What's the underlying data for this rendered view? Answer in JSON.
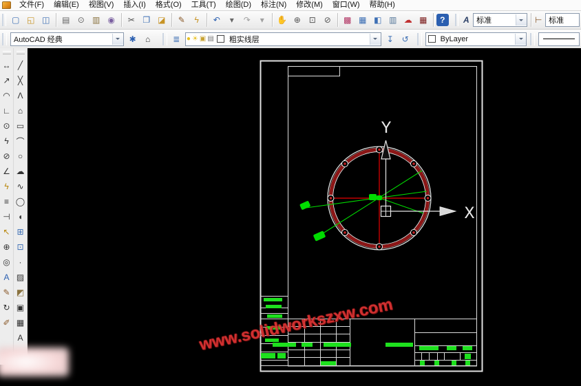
{
  "menu_bar": {
    "items": [
      "文件(F)",
      "编辑(E)",
      "视图(V)",
      "插入(I)",
      "格式(O)",
      "工具(T)",
      "绘图(D)",
      "标注(N)",
      "修改(M)",
      "窗口(W)",
      "帮助(H)"
    ]
  },
  "standard_toolbar": {
    "buttons": [
      {
        "name": "new-file",
        "glyph": "▢",
        "color": "#3d6fb4"
      },
      {
        "name": "open-file",
        "glyph": "◱",
        "color": "#c79324"
      },
      {
        "name": "save-file",
        "glyph": "◫",
        "color": "#3d6fb4"
      },
      {
        "sep": true
      },
      {
        "name": "plot",
        "glyph": "▤",
        "color": "#666666"
      },
      {
        "name": "plot-preview",
        "glyph": "⊙",
        "color": "#666666"
      },
      {
        "name": "publish",
        "glyph": "▥",
        "color": "#8a7340"
      },
      {
        "name": "3d-dwf",
        "glyph": "◉",
        "color": "#7a5fa0"
      },
      {
        "sep": true
      },
      {
        "name": "cut",
        "glyph": "✂",
        "color": "#555555"
      },
      {
        "name": "copy",
        "glyph": "❐",
        "color": "#3d6fb4"
      },
      {
        "name": "paste",
        "glyph": "◪",
        "color": "#c79324"
      },
      {
        "sep": true
      },
      {
        "name": "match-properties",
        "glyph": "✎",
        "color": "#8a5a2a"
      },
      {
        "name": "block-editor",
        "glyph": "ϟ",
        "color": "#c79324"
      },
      {
        "sep": true
      },
      {
        "name": "undo",
        "glyph": "↶",
        "color": "#2b5fb0"
      },
      {
        "name": "undo-options",
        "glyph": "▾",
        "color": "#666666"
      },
      {
        "name": "redo",
        "glyph": "↷",
        "color": "#a0a0a0"
      },
      {
        "name": "redo-options",
        "glyph": "▾",
        "color": "#a0a0a0"
      },
      {
        "sep": true
      },
      {
        "name": "pan-realtime",
        "glyph": "✋",
        "color": "#c79324"
      },
      {
        "name": "zoom-realtime",
        "glyph": "⊕",
        "color": "#555555"
      },
      {
        "name": "zoom-window",
        "glyph": "⊡",
        "color": "#555555"
      },
      {
        "name": "zoom-previous",
        "glyph": "⊘",
        "color": "#555555"
      },
      {
        "sep": true
      },
      {
        "name": "properties-palette",
        "glyph": "▩",
        "color": "#b03060"
      },
      {
        "name": "designcenter",
        "glyph": "▦",
        "color": "#3d6fb4"
      },
      {
        "name": "tool-palettes",
        "glyph": "◧",
        "color": "#3d6fb4"
      },
      {
        "name": "sheet-set-manager",
        "glyph": "▥",
        "color": "#557799"
      },
      {
        "name": "markup-set-manager",
        "glyph": "☁",
        "color": "#c03030"
      },
      {
        "name": "quickcalc",
        "glyph": "▦",
        "color": "#7a1a1a"
      },
      {
        "sep": true
      },
      {
        "name": "help",
        "glyph": "?",
        "color": "#ffffff",
        "bg": "#2b5fb0"
      }
    ]
  },
  "styles_toolbar": {
    "text_style_icon": {
      "name": "text-style-manager",
      "glyph": "A",
      "color": "#2b3f66"
    },
    "text_style_value": "标准",
    "dim_style_icon": {
      "name": "dim-style-manager",
      "glyph": "⊢",
      "color": "#8a5a2a"
    },
    "dim_style_value": "标准"
  },
  "workspace_toolbar": {
    "workspace_value": "AutoCAD 经典",
    "buttons": [
      {
        "name": "workspace-settings",
        "glyph": "✱",
        "color": "#2b5fb0"
      },
      {
        "name": "my-workspace",
        "glyph": "⌂",
        "color": "#333333"
      }
    ]
  },
  "layer_toolbar": {
    "manager_button": {
      "name": "layer-properties-manager",
      "glyph": "≣",
      "color": "#3d6fb4"
    },
    "state_icons": [
      {
        "name": "layer-on-icon",
        "glyph": "●",
        "color": "#e8c020"
      },
      {
        "name": "layer-freeze-icon",
        "glyph": "☀",
        "color": "#e8c020"
      },
      {
        "name": "layer-lock-icon",
        "glyph": "▣",
        "color": "#c7a334"
      },
      {
        "name": "layer-plot-icon",
        "glyph": "▤",
        "color": "#777777"
      }
    ],
    "current_layer": "粗实线层",
    "buttons": [
      {
        "name": "make-object-layer-current",
        "glyph": "↧",
        "color": "#3d6fb4"
      },
      {
        "name": "layer-previous",
        "glyph": "↺",
        "color": "#3d6fb4"
      }
    ]
  },
  "properties_toolbar": {
    "color_value": "ByLayer"
  },
  "dimension_toolbar": {
    "buttons": [
      {
        "name": "linear-dimension",
        "glyph": "↔",
        "color": "#333333"
      },
      {
        "name": "aligned-dimension",
        "glyph": "↗",
        "color": "#333333"
      },
      {
        "name": "arc-length-dimension",
        "glyph": "◠",
        "color": "#333333"
      },
      {
        "name": "ordinate-dimension",
        "glyph": "∟",
        "color": "#333333"
      },
      {
        "name": "radius-dimension",
        "glyph": "⊙",
        "color": "#333333"
      },
      {
        "name": "jogged-dimension",
        "glyph": "ϟ",
        "color": "#333333"
      },
      {
        "name": "diameter-dimension",
        "glyph": "⊘",
        "color": "#333333"
      },
      {
        "name": "angular-dimension",
        "glyph": "∠",
        "color": "#333333"
      },
      {
        "name": "quick-dimension",
        "glyph": "ϟ",
        "color": "#b8860b"
      },
      {
        "name": "baseline-dimension",
        "glyph": "≡",
        "color": "#333333"
      },
      {
        "name": "continue-dimension",
        "glyph": "⊣",
        "color": "#333333"
      },
      {
        "name": "quick-leader",
        "glyph": "↖",
        "color": "#b8860b"
      },
      {
        "name": "tolerance",
        "glyph": "⊕",
        "color": "#333333"
      },
      {
        "name": "center-mark",
        "glyph": "◎",
        "color": "#333333"
      },
      {
        "name": "dimension-text-edit",
        "glyph": "A",
        "color": "#2b5fb0"
      },
      {
        "name": "dimension-edit",
        "glyph": "✎",
        "color": "#8a5a2a"
      },
      {
        "name": "dimension-update",
        "glyph": "↻",
        "color": "#333333"
      },
      {
        "name": "dimension-style",
        "glyph": "✐",
        "color": "#8a5a2a"
      }
    ]
  },
  "draw_toolbar": {
    "buttons": [
      {
        "name": "line",
        "glyph": "╱",
        "color": "#333333"
      },
      {
        "name": "construction-line",
        "glyph": "╳",
        "color": "#333333"
      },
      {
        "name": "polyline",
        "glyph": "Λ",
        "color": "#333333"
      },
      {
        "name": "polygon",
        "glyph": "⌂",
        "color": "#333333"
      },
      {
        "name": "rectangle",
        "glyph": "▭",
        "color": "#333333"
      },
      {
        "name": "arc",
        "glyph": "⌒",
        "color": "#333333"
      },
      {
        "name": "circle",
        "glyph": "○",
        "color": "#333333"
      },
      {
        "name": "revision-cloud",
        "glyph": "☁",
        "color": "#333333"
      },
      {
        "name": "spline",
        "glyph": "∿",
        "color": "#333333"
      },
      {
        "name": "ellipse",
        "glyph": "◯",
        "color": "#333333"
      },
      {
        "name": "ellipse-arc",
        "glyph": "◖",
        "color": "#333333"
      },
      {
        "name": "insert-block",
        "glyph": "⊞",
        "color": "#3d6fb4"
      },
      {
        "name": "make-block",
        "glyph": "⊡",
        "color": "#3d6fb4"
      },
      {
        "name": "point",
        "glyph": "·",
        "color": "#333333"
      },
      {
        "name": "hatch",
        "glyph": "▨",
        "color": "#333333"
      },
      {
        "name": "gradient",
        "glyph": "◩",
        "color": "#8a7340"
      },
      {
        "name": "region",
        "glyph": "▣",
        "color": "#333333"
      },
      {
        "name": "table",
        "glyph": "▦",
        "color": "#333333"
      },
      {
        "name": "multiline-text",
        "glyph": "A",
        "color": "#333333"
      }
    ]
  },
  "drawing": {
    "ucs_x_label": "X",
    "ucs_y_label": "Y",
    "frame_color": "#e0e0e0",
    "ring_color": "#8b1616",
    "centerline_color": "#e80000",
    "annotation_color": "#00dd00"
  },
  "watermark": {
    "text": "www.solidworkszxw.com",
    "color": "#e23535"
  }
}
